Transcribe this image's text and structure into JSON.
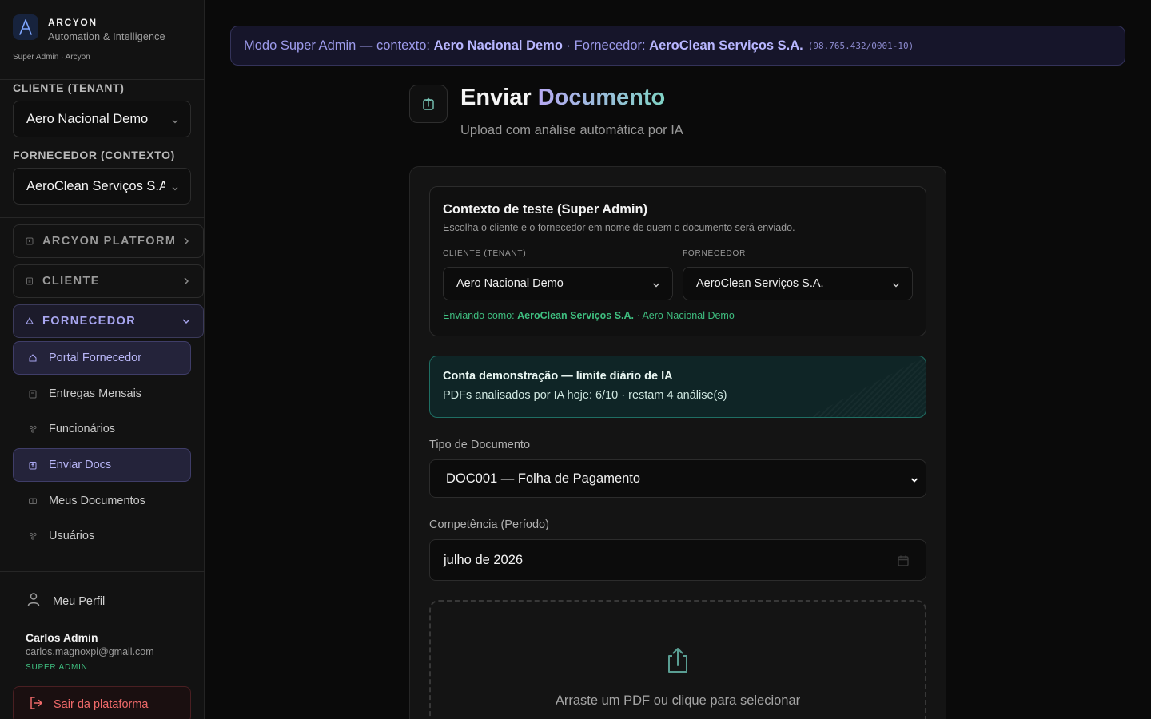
{
  "sidebar": {
    "brand_name": "ARCYON",
    "brand_subtitle": "Automation & Intelligence",
    "brand_role": "Super Admin · Arcyon",
    "tenant_label": "CLIENTE (TENANT)",
    "tenant_value": "Aero Nacional Demo",
    "supplier_label": "FORNECEDOR (CONTEXTO)",
    "supplier_value": "AeroClean Serviços S.A.",
    "groups": [
      {
        "label": "ARCYON PLATFORM",
        "icon": "platform-icon",
        "state": "collapsed"
      },
      {
        "label": "CLIENTE",
        "icon": "client-icon",
        "state": "collapsed"
      },
      {
        "label": "FORNECEDOR",
        "icon": "supplier-icon",
        "state": "expanded"
      }
    ],
    "items": [
      {
        "label": "Portal Fornecedor",
        "icon": "portal-icon",
        "active": true
      },
      {
        "label": "Entregas Mensais",
        "icon": "deliveries-icon",
        "active": false
      },
      {
        "label": "Funcionários",
        "icon": "employees-icon",
        "active": false
      },
      {
        "label": "Enviar Docs",
        "icon": "upload-icon",
        "active": true
      },
      {
        "label": "Meus Documentos",
        "icon": "documents-icon",
        "active": false
      },
      {
        "label": "Usuários",
        "icon": "users-icon",
        "active": false
      }
    ],
    "profile_label": "Meu Perfil",
    "user": {
      "name": "Carlos Admin",
      "email": "carlos.magnoxpi@gmail.com",
      "role": "SUPER ADMIN"
    },
    "logout_label": "Sair da plataforma"
  },
  "banner": {
    "prefix": "Modo Super Admin — contexto:",
    "tenant": "Aero Nacional Demo",
    "middle": "· Fornecedor:",
    "supplier": "AeroClean Serviços S.A.",
    "cnpj": "(98.765.432/0001-10)"
  },
  "page": {
    "title_main": "Enviar",
    "title_accent": "Documento",
    "subtitle": "Upload com análise automática por IA"
  },
  "context": {
    "title": "Contexto de teste (Super Admin)",
    "description": "Escolha o cliente e o fornecedor em nome de quem o documento será enviado.",
    "tenant_label": "CLIENTE (TENANT)",
    "tenant_value": "Aero Nacional Demo",
    "supplier_label": "FORNECEDOR",
    "supplier_value": "AeroClean Serviços S.A.",
    "sending_prefix": "Enviando como:",
    "sending_supplier": "AeroClean Serviços S.A.",
    "sending_suffix": "· Aero Nacional Demo"
  },
  "demo": {
    "title": "Conta demonstração — limite diário de IA",
    "text": "PDFs analisados por IA hoje: 6/10 · restam 4 análise(s)"
  },
  "form": {
    "doc_type_label": "Tipo de Documento",
    "doc_type_value": "DOC001 — Folha de Pagamento",
    "period_label": "Competência (Período)",
    "period_value": "julho de 2026",
    "dropzone_text": "Arraste um PDF ou clique para selecionar"
  },
  "colors": {
    "accent": "#a8a6f0",
    "success": "#3fbf80",
    "danger": "#f06a6a",
    "background": "#0a0a0a"
  }
}
